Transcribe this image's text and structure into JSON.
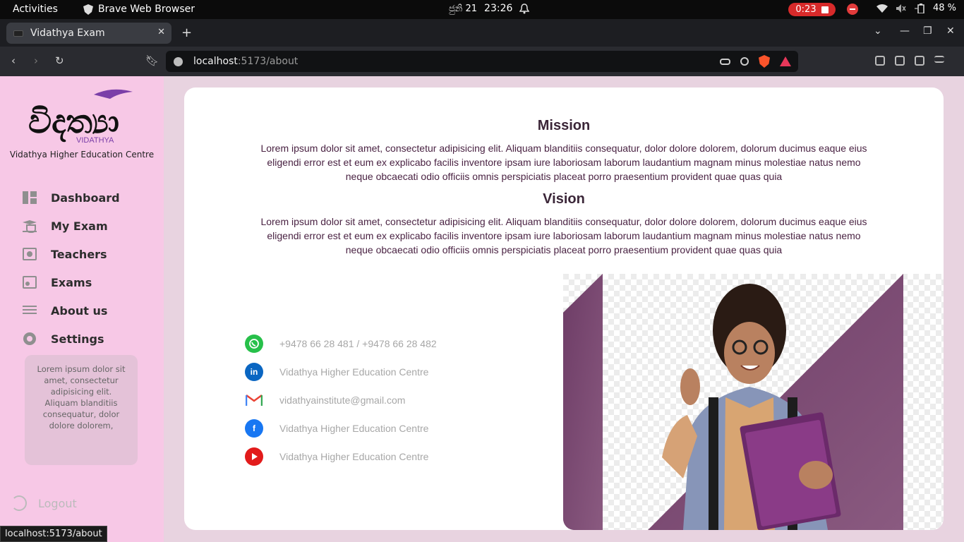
{
  "system": {
    "activities": "Activities",
    "app_name": "Brave Web Browser",
    "date": "ජුනි 21",
    "time": "23:26",
    "recording_time": "0:23",
    "battery": "48 %"
  },
  "browser": {
    "tab_title": "Vidathya Exam",
    "url_host": "localhost",
    "url_path": ":5173/about",
    "status_url": "localhost:5173/about"
  },
  "sidebar": {
    "logo_text": "විදත්‍යා",
    "logo_subtext": "VIDATHYA",
    "centre_name": "Vidathya Higher Education Centre",
    "items": [
      {
        "label": "Dashboard",
        "icon": "dashboard-icon"
      },
      {
        "label": "My Exam",
        "icon": "graduation-cap-icon"
      },
      {
        "label": "Teachers",
        "icon": "teacher-board-icon"
      },
      {
        "label": "Exams",
        "icon": "exams-card-icon"
      },
      {
        "label": "About us",
        "icon": "list-lines-icon"
      },
      {
        "label": "Settings",
        "icon": "gear-icon"
      }
    ],
    "note": "Lorem ipsum dolor sit amet, consectetur adipisicing elit. Aliquam blanditiis consequatur, dolor dolore dolorem,",
    "logout": "Logout"
  },
  "main": {
    "mission_title": "Mission",
    "mission_text": "Lorem ipsum dolor sit amet, consectetur adipisicing elit. Aliquam blanditiis consequatur, dolor dolore dolorem, dolorum ducimus eaque eius eligendi error est et eum ex explicabo facilis inventore ipsam iure laboriosam laborum laudantium magnam minus molestiae natus nemo neque obcaecati odio officiis omnis perspiciatis placeat porro praesentium provident quae quas quia",
    "vision_title": "Vision",
    "vision_text": "Lorem ipsum dolor sit amet, consectetur adipisicing elit. Aliquam blanditiis consequatur, dolor dolore dolorem, dolorum ducimus eaque eius eligendi error est et eum ex explicabo facilis inventore ipsam iure laboriosam laborum laudantium magnam minus molestiae natus nemo neque obcaecati odio officiis omnis perspiciatis placeat porro praesentium provident quae quas quia",
    "contacts": [
      {
        "icon": "whatsapp-icon",
        "text": "+9478 66 28 481 / +9478 66 28 482"
      },
      {
        "icon": "linkedin-icon",
        "text": "Vidathya Higher Education Centre"
      },
      {
        "icon": "gmail-icon",
        "text": "vidathyainstitute@gmail.com"
      },
      {
        "icon": "facebook-icon",
        "text": "Vidathya Higher Education Centre"
      },
      {
        "icon": "youtube-icon",
        "text": "Vidathya Higher Education Centre"
      }
    ]
  },
  "colors": {
    "sidebar_bg": "#f7c8e6",
    "page_bg": "#e8d3e0",
    "accent_purple": "#7b3a6e",
    "text_dark": "#4a2343"
  }
}
